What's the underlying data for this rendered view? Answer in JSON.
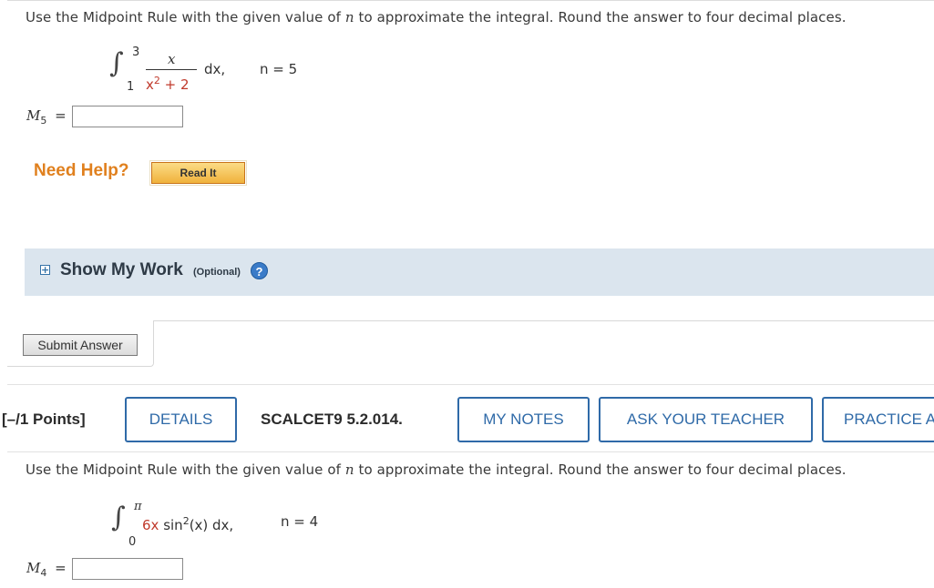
{
  "question1": {
    "prompt_pre": "Use the Midpoint Rule with the given value of ",
    "prompt_var": "n",
    "prompt_post": " to approximate the integral. Round the answer to four decimal places.",
    "upper_limit": "3",
    "lower_limit": "1",
    "numerator": "x",
    "denominator_base": "x",
    "denominator_exp": "2",
    "denominator_rest": " + 2",
    "differential": "dx,",
    "n_label": "n = 5",
    "answer_var": "M",
    "answer_sub": "5",
    "answer_eq": "=",
    "answer_value": ""
  },
  "help": {
    "need_help": "Need Help?",
    "read_it": "Read It"
  },
  "show_my_work": {
    "toggle": "+",
    "title": "Show My Work",
    "optional": "(Optional)",
    "help_icon": "?"
  },
  "submit_label": "Submit Answer",
  "question2_header": {
    "points": "[–/1 Points]",
    "details": "DETAILS",
    "id": "SCALCET9 5.2.014.",
    "my_notes": "MY NOTES",
    "ask_teacher": "ASK YOUR TEACHER",
    "practice": "PRACTICE ANOTHER"
  },
  "question2": {
    "prompt_pre": "Use the Midpoint Rule with the given value of ",
    "prompt_var": "n",
    "prompt_post": " to approximate the integral. Round the answer to four decimal places.",
    "upper_limit": "π",
    "lower_limit": "0",
    "integrand_coef": "6x",
    "integrand_func": " sin",
    "integrand_exp": "2",
    "integrand_arg": "(x) dx,",
    "n_label": "n = 4",
    "answer_var": "M",
    "answer_sub": "4",
    "answer_eq": "=",
    "answer_value": ""
  },
  "colors": {
    "accent_blue": "#2f6aa8",
    "help_orange": "#e0801e",
    "highlight_red": "#c0392b",
    "panel_bg": "#dbe5ee"
  }
}
